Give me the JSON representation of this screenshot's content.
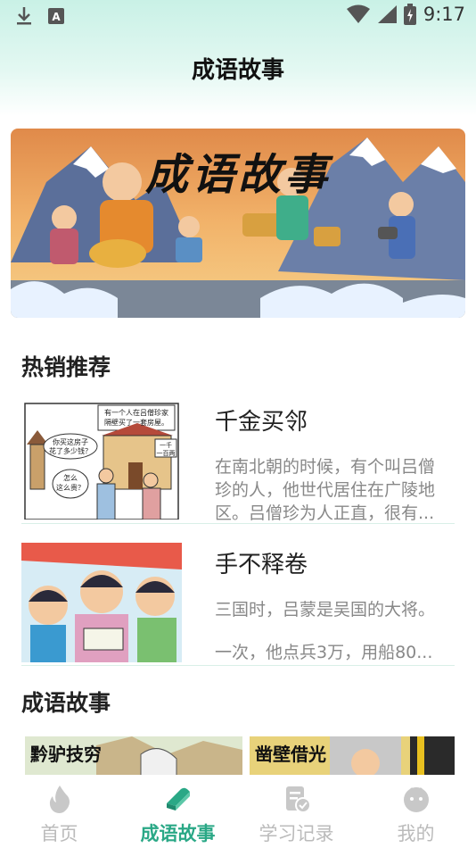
{
  "status_bar": {
    "time": "9:17"
  },
  "header": {
    "title": "成语故事"
  },
  "banner": {
    "title": "成语故事"
  },
  "hot": {
    "section_title": "热销推荐",
    "items": [
      {
        "title": "千金买邻",
        "desc_lines": [
          "在南北朝的时候，有个叫吕僧",
          "珍的人，他世代居住在广陵地",
          "区。吕僧珍为人正直，很有..."
        ],
        "thumb_text": [
          "有一个人在吕僧珍家",
          "隔壁买了一套房屋。",
          "你买这房子",
          "花了多少钱？",
          "怎么",
          "这么贵？",
          "一千",
          "一百两"
        ]
      },
      {
        "title": "手不释卷",
        "desc_lines": [
          "三国时，吕蒙是吴国的大将。",
          "一次，他点兵3万，用船80..."
        ]
      }
    ]
  },
  "stories": {
    "section_title": "成语故事",
    "cards": [
      {
        "label": "黔驴技穷"
      },
      {
        "label": "凿壁借光"
      }
    ]
  },
  "tabbar": {
    "tabs": [
      {
        "label": "首页",
        "icon": "flame-icon"
      },
      {
        "label": "成语故事",
        "icon": "book-icon",
        "active": true
      },
      {
        "label": "学习记录",
        "icon": "record-icon"
      },
      {
        "label": "我的",
        "icon": "profile-icon"
      }
    ]
  },
  "colors": {
    "accent": "#2aa886",
    "header_bg": "#c9f1e6",
    "inactive": "#bbbbbb"
  }
}
